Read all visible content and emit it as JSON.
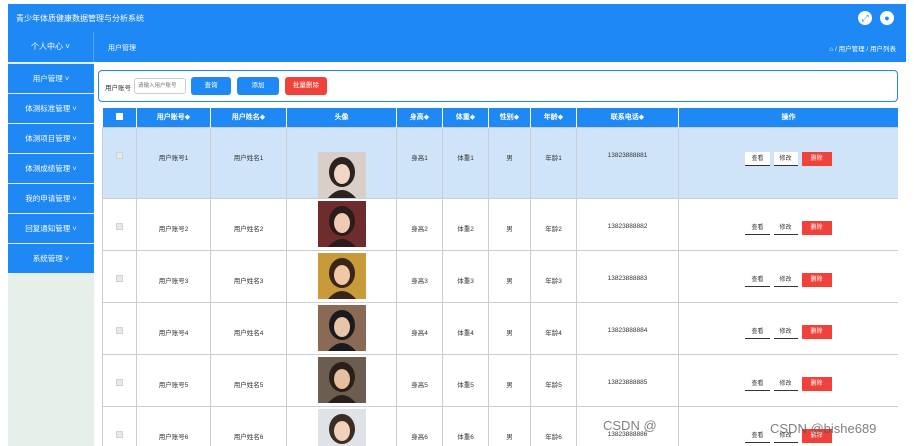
{
  "app": {
    "title": "青少年体质健康数据管理与分析系统",
    "icons": [
      "fullscreen-icon",
      "user-icon"
    ]
  },
  "nav": {
    "personal_center": "个人中心",
    "page_title": "用户管理",
    "breadcrumb": "⌂ / 用户管理 / 用户列表"
  },
  "sidebar": {
    "items": [
      {
        "label": "用户管理"
      },
      {
        "label": "体测标准管理"
      },
      {
        "label": "体测项目管理"
      },
      {
        "label": "体测成绩管理"
      },
      {
        "label": "我的申请管理"
      },
      {
        "label": "回复通知管理"
      },
      {
        "label": "系统管理"
      }
    ]
  },
  "toolbar": {
    "account_label": "用户账号",
    "account_placeholder": "请输入用户账号",
    "search": "查询",
    "add": "添加",
    "batch_delete": "批量删除"
  },
  "table": {
    "headers": {
      "account": "用户账号◆",
      "name": "用户姓名◆",
      "avatar": "头像",
      "height": "身高◆",
      "weight": "体重◆",
      "gender": "性别◆",
      "age": "年龄◆",
      "phone": "联系电话◆",
      "actions": "操作"
    },
    "action_labels": {
      "view": "查看",
      "edit": "修改",
      "delete": "删除"
    },
    "rows": [
      {
        "account": "用户账号1",
        "name": "用户姓名1",
        "height": "身高1",
        "weight": "体重1",
        "gender": "男",
        "age": "年龄1",
        "phone": "13823888881"
      },
      {
        "account": "用户账号2",
        "name": "用户姓名2",
        "height": "身高2",
        "weight": "体重2",
        "gender": "男",
        "age": "年龄2",
        "phone": "13823888882"
      },
      {
        "account": "用户账号3",
        "name": "用户姓名3",
        "height": "身高3",
        "weight": "体重3",
        "gender": "男",
        "age": "年龄3",
        "phone": "13823888883"
      },
      {
        "account": "用户账号4",
        "name": "用户姓名4",
        "height": "身高4",
        "weight": "体重4",
        "gender": "男",
        "age": "年龄4",
        "phone": "13823888884"
      },
      {
        "account": "用户账号5",
        "name": "用户姓名5",
        "height": "身高5",
        "weight": "体重5",
        "gender": "男",
        "age": "年龄5",
        "phone": "13823888885"
      },
      {
        "account": "用户账号6",
        "name": "用户姓名6",
        "height": "身高6",
        "weight": "体重6",
        "gender": "男",
        "age": "年龄6",
        "phone": "13823888886"
      }
    ]
  },
  "watermark": {
    "left": "CSDN @",
    "right": "CSDN @bishe689"
  },
  "colors": {
    "primary": "#1e88f5",
    "danger": "#f0413a",
    "sidebar_bg": "#e6efe9",
    "selected_row": "#cfe4f9"
  }
}
